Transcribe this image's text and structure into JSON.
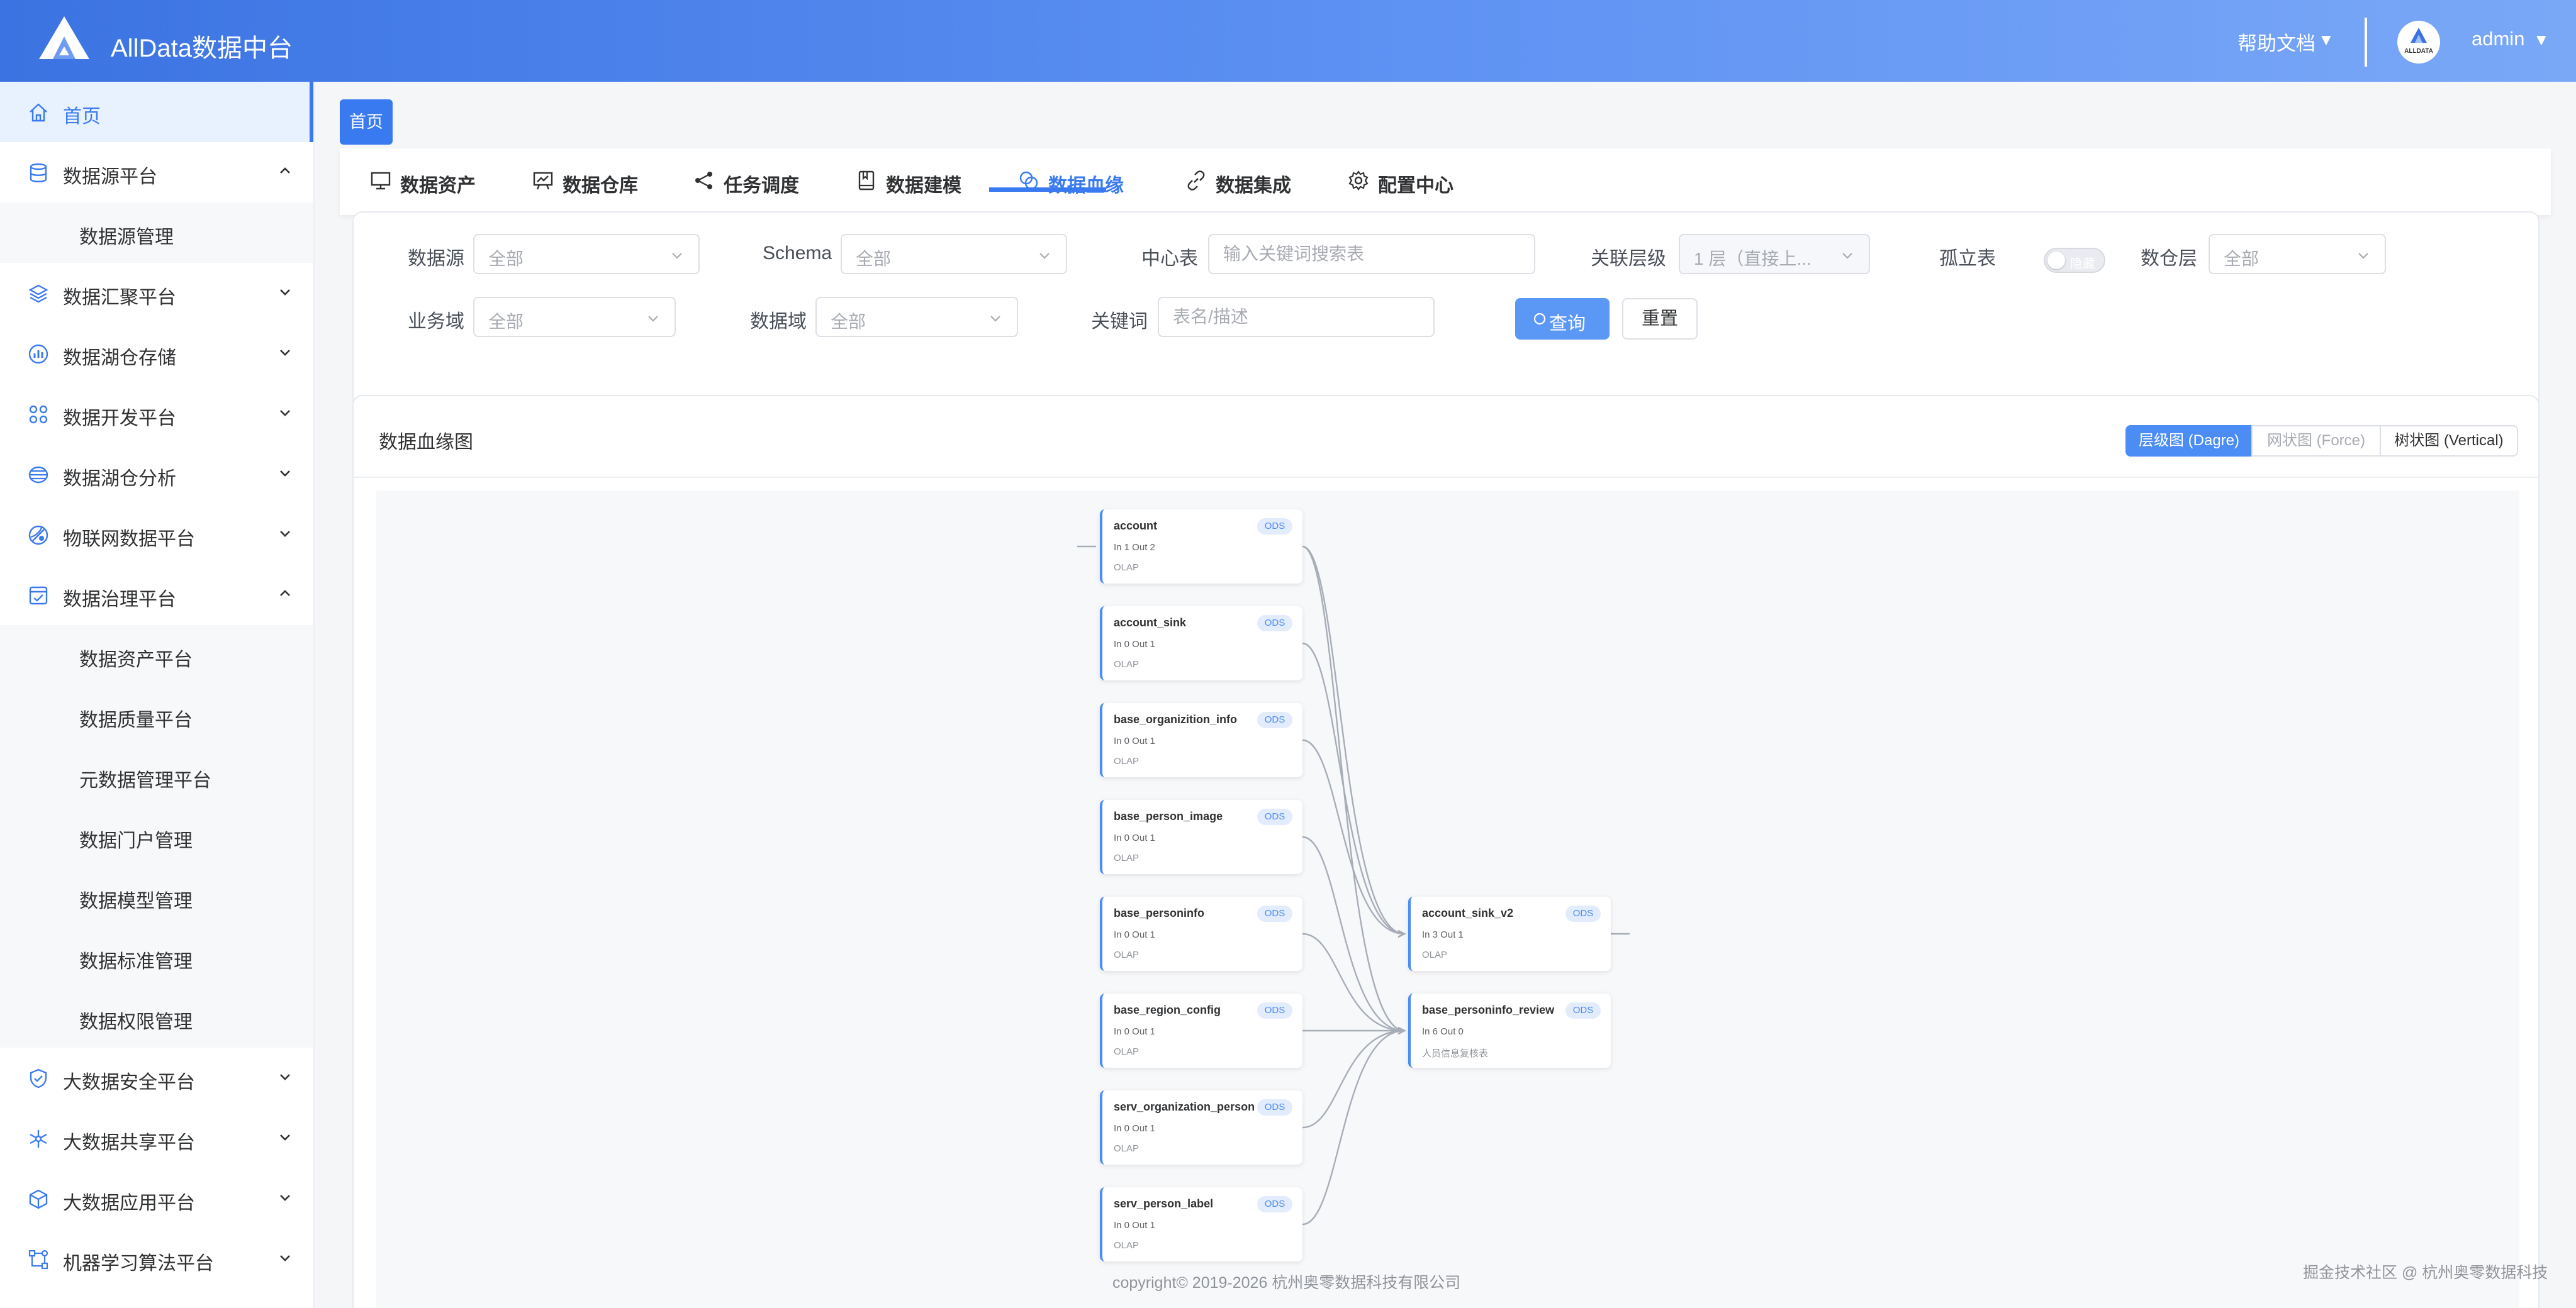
{
  "header": {
    "title": "AllData数据中台",
    "help": "帮助文档",
    "caret": "▼",
    "avatar_label": "ALLDATA",
    "user": "admin"
  },
  "sidebar": {
    "items": [
      {
        "label": "首页",
        "icon": "home-icon",
        "active": true
      },
      {
        "label": "数据源平台",
        "icon": "database-icon",
        "expanded": true
      },
      {
        "label": "数据源管理",
        "sub": true
      },
      {
        "label": "数据汇聚平台",
        "icon": "layers-icon"
      },
      {
        "label": "数据湖仓存储",
        "icon": "bar-chart-icon"
      },
      {
        "label": "数据开发平台",
        "icon": "grid-icon"
      },
      {
        "label": "数据湖仓分析",
        "icon": "cylinder-icon"
      },
      {
        "label": "物联网数据平台",
        "icon": "globe-icon"
      },
      {
        "label": "数据治理平台",
        "icon": "check-board-icon",
        "expanded": true
      },
      {
        "label": "数据资产平台",
        "sub": true
      },
      {
        "label": "数据质量平台",
        "sub": true
      },
      {
        "label": "元数据管理平台",
        "sub": true
      },
      {
        "label": "数据门户管理",
        "sub": true
      },
      {
        "label": "数据模型管理",
        "sub": true
      },
      {
        "label": "数据标准管理",
        "sub": true
      },
      {
        "label": "数据权限管理",
        "sub": true
      },
      {
        "label": "大数据安全平台",
        "icon": "shield-icon"
      },
      {
        "label": "大数据共享平台",
        "icon": "share-icon"
      },
      {
        "label": "大数据应用平台",
        "icon": "cube-icon"
      },
      {
        "label": "机器学习算法平台",
        "icon": "nodes-icon"
      }
    ]
  },
  "breadcrumb": {
    "home": "首页"
  },
  "tabs": [
    {
      "label": "数据资产",
      "icon": "monitor-icon"
    },
    {
      "label": "数据仓库",
      "icon": "board-chart-icon"
    },
    {
      "label": "任务调度",
      "icon": "share-node-icon"
    },
    {
      "label": "数据建模",
      "icon": "book-icon"
    },
    {
      "label": "数据血缘",
      "icon": "link-circles-icon",
      "active": true
    },
    {
      "label": "数据集成",
      "icon": "chain-icon"
    },
    {
      "label": "配置中心",
      "icon": "gear-icon"
    }
  ],
  "filters": {
    "datasource": {
      "label": "数据源",
      "value": "全部"
    },
    "schema": {
      "label": "Schema",
      "value": "全部"
    },
    "center_table": {
      "label": "中心表",
      "placeholder": "输入关键词搜索表"
    },
    "depth": {
      "label": "关联层级",
      "value": "1 层（直接上..."
    },
    "isolated": {
      "label": "孤立表",
      "switch_text": "隐藏"
    },
    "warehouse_layer": {
      "label": "数仓层",
      "value": "全部"
    },
    "business_domain": {
      "label": "业务域",
      "value": "全部"
    },
    "data_domain": {
      "label": "数据域",
      "value": "全部"
    },
    "keyword": {
      "label": "关键词",
      "placeholder": "表名/描述"
    },
    "query_button": "查询",
    "reset_button": "重置"
  },
  "lineage": {
    "title": "数据血缘图",
    "views": [
      {
        "label": "层级图 (Dagre)",
        "active": true
      },
      {
        "label": "网状图 (Force)"
      },
      {
        "label": "树状图 (Vertical)"
      }
    ],
    "sources": [
      {
        "name": "account",
        "badge": "ODS",
        "io": "In 1   Out 2",
        "desc": "OLAP"
      },
      {
        "name": "account_sink",
        "badge": "ODS",
        "io": "In 0   Out 1",
        "desc": "OLAP"
      },
      {
        "name": "base_organizition_info",
        "badge": "ODS",
        "io": "In 0   Out 1",
        "desc": "OLAP"
      },
      {
        "name": "base_person_image",
        "badge": "ODS",
        "io": "In 0   Out 1",
        "desc": "OLAP"
      },
      {
        "name": "base_personinfo",
        "badge": "ODS",
        "io": "In 0   Out 1",
        "desc": "OLAP"
      },
      {
        "name": "base_region_config",
        "badge": "ODS",
        "io": "In 0   Out 1",
        "desc": "OLAP"
      },
      {
        "name": "serv_organization_person",
        "badge": "ODS",
        "io": "In 0   Out 1",
        "desc": "OLAP"
      },
      {
        "name": "serv_person_label",
        "badge": "ODS",
        "io": "In 0   Out 1",
        "desc": "OLAP"
      }
    ],
    "targets": [
      {
        "name": "account_sink_v2",
        "badge": "ODS",
        "io": "In 3   Out 1",
        "desc": "OLAP"
      },
      {
        "name": "base_personinfo_review",
        "badge": "ODS",
        "io": "In 6   Out 0",
        "desc": "人员信息复核表"
      }
    ],
    "edges": [
      {
        "from": "account",
        "to": "account_sink_v2"
      },
      {
        "from": "account",
        "to": "base_personinfo_review"
      },
      {
        "from": "account_sink",
        "to": "account_sink_v2"
      },
      {
        "from": "base_organizition_info",
        "to": "account_sink_v2"
      },
      {
        "from": "base_person_image",
        "to": "base_personinfo_review"
      },
      {
        "from": "base_personinfo",
        "to": "base_personinfo_review"
      },
      {
        "from": "base_region_config",
        "to": "base_personinfo_review"
      },
      {
        "from": "serv_organization_person",
        "to": "base_personinfo_review"
      },
      {
        "from": "serv_person_label",
        "to": "base_personinfo_review"
      }
    ]
  },
  "footer": {
    "copyright": "copyright© 2019-2026 杭州奥零数据科技有限公司",
    "watermark": "掘金技术社区 @ 杭州奥零数据科技"
  }
}
